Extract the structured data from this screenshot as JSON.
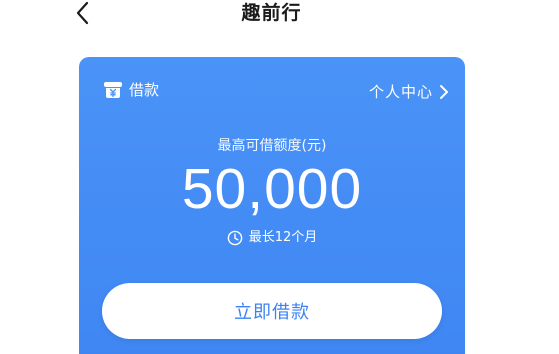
{
  "nav": {
    "title": "趣前行",
    "back_icon": "chevron-left-icon"
  },
  "card": {
    "label": "借款",
    "label_icon": "loan-icon",
    "personal_center_label": "个人中心",
    "personal_center_icon": "chevron-right-icon",
    "limit_label": "最高可借额度(元)",
    "limit_amount": "50,000",
    "term_icon": "clock-icon",
    "term_label": "最长12个月",
    "borrow_button_label": "立即借款"
  },
  "colors": {
    "card_background": "#4a93f7",
    "button_text": "#3d82f2",
    "title_text": "#1b1b1b"
  }
}
